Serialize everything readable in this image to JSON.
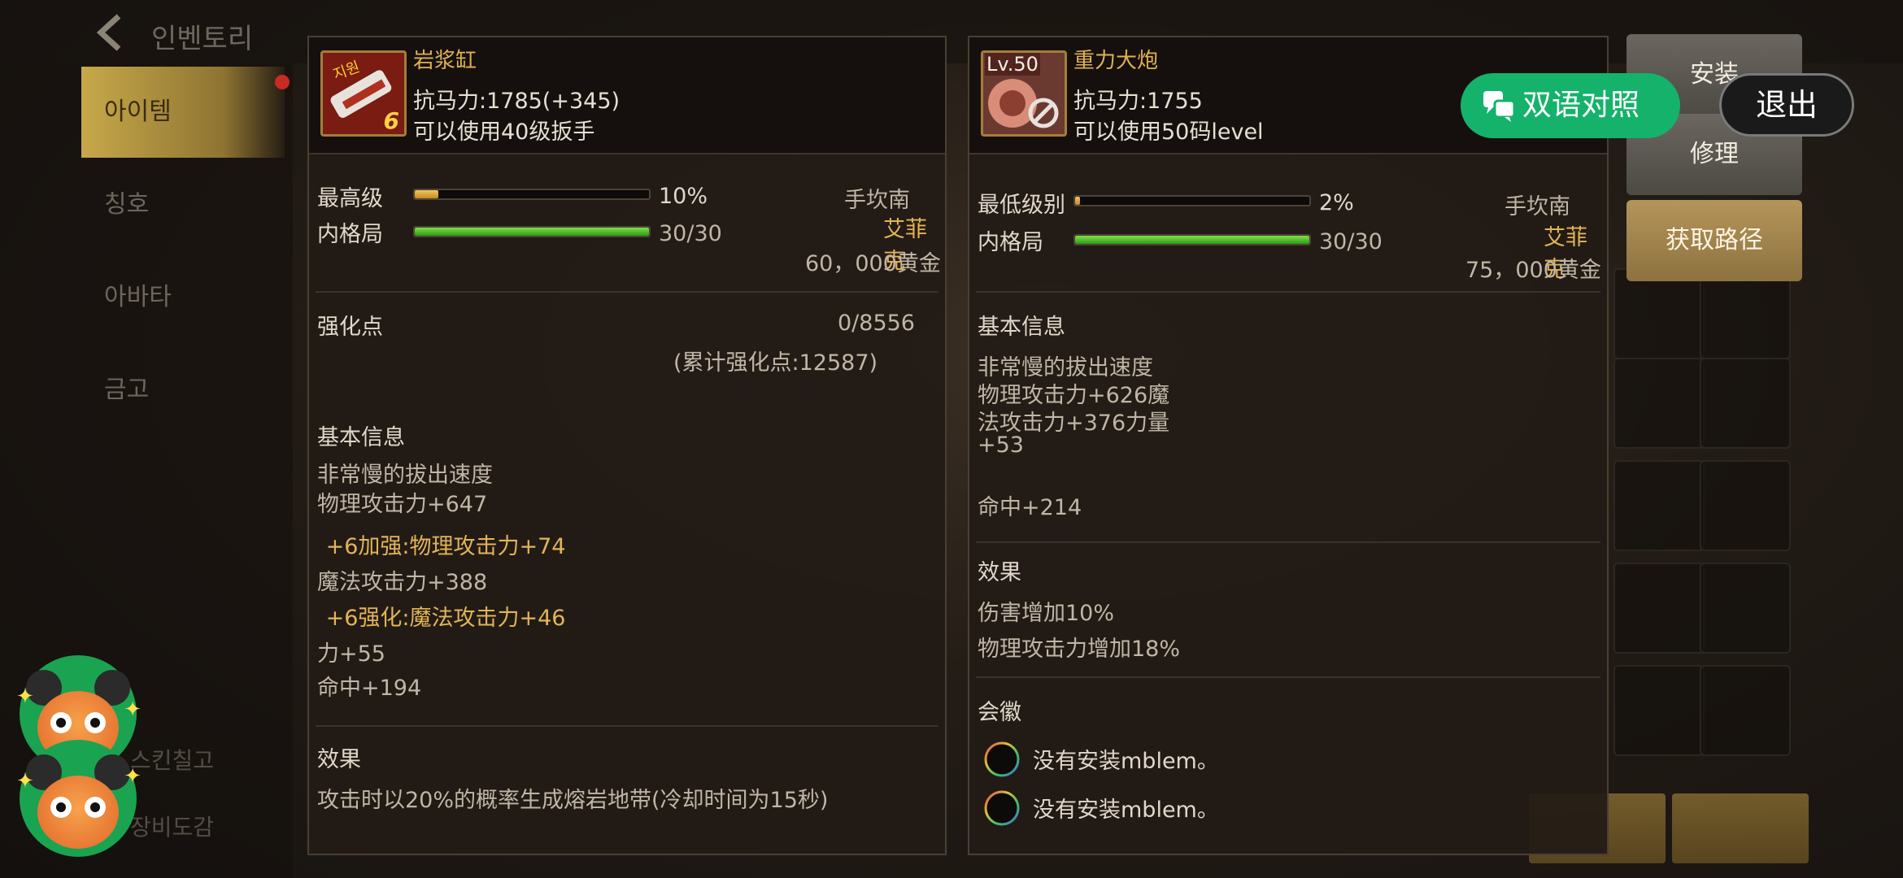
{
  "background": {
    "title": "인벤토리",
    "sidebar_tabs": [
      "아이템",
      "칭호",
      "아바타",
      "금고"
    ],
    "sidebar_bottom": [
      "스킨칠고",
      "장비도감"
    ]
  },
  "left_item": {
    "name": "岩浆缸",
    "icon_level_badge": "6",
    "icon_top_text": "지원",
    "stat_line": "抗马力:1785(+345)",
    "usage_line": "可以使用40级扳手",
    "bar1_label": "最高级",
    "bar1_percent": 10,
    "bar1_text": "10%",
    "bar2_label": "内格局",
    "bar2_percent": 100,
    "bar2_text": "30/30",
    "type": "手坎南",
    "class": "艾菲克",
    "price": "60，000黄金",
    "enhance_label": "强化点",
    "enhance_value": "0/8556",
    "enhance_total": "(累计强化点:12587)",
    "basic_info_label": "基本信息",
    "basic_lines": [
      {
        "text": "非常慢的拔出速度",
        "style": "plain"
      },
      {
        "text": "物理攻击力+647",
        "style": "plain"
      },
      {
        "text": " +6加强:物理攻击力+74",
        "style": "gold"
      },
      {
        "text": "魔法攻击力+388",
        "style": "plain"
      },
      {
        "text": " +6强化:魔法攻击力+46",
        "style": "gold"
      },
      {
        "text": "力+55",
        "style": "plain"
      },
      {
        "text": "命中+194",
        "style": "plain"
      }
    ],
    "effect_label": "效果",
    "effect_lines": [
      "攻击时以20%的概率生成熔岩地带(冷却时间为15秒)"
    ]
  },
  "right_item": {
    "name": "重力大炮",
    "icon_level_text": "Lv.50",
    "stat_line": "抗马力:1755",
    "usage_line": "可以使用50码level",
    "bar1_label": "最低级别",
    "bar1_percent": 2,
    "bar1_text": "2%",
    "bar2_label": "内格局",
    "bar2_percent": 100,
    "bar2_text": "30/30",
    "type": "手坎南",
    "class": "艾菲克",
    "price": "75，000黄金",
    "basic_info_label": "基本信息",
    "basic_lines": [
      "非常慢的拔出速度",
      "物理攻击力+626魔",
      "法攻击力+376力量",
      "+53",
      "",
      "命中+214"
    ],
    "effect_label": "效果",
    "effect_lines": [
      "伤害增加10%",
      "物理攻击力增加18%"
    ],
    "emblem_label": "会徽",
    "emblem_slots": [
      "没有安装mblem。",
      "没有安装mblem。"
    ]
  },
  "actions": {
    "install": "安装",
    "repair": "修理",
    "get_path": "获取路径"
  },
  "overlay": {
    "bilingual_label": "双语对照",
    "exit_label": "退出"
  },
  "colors": {
    "gold_text": "#e2b457",
    "bilingual_green": "#15b26b",
    "panel_bg": "#221b15"
  }
}
